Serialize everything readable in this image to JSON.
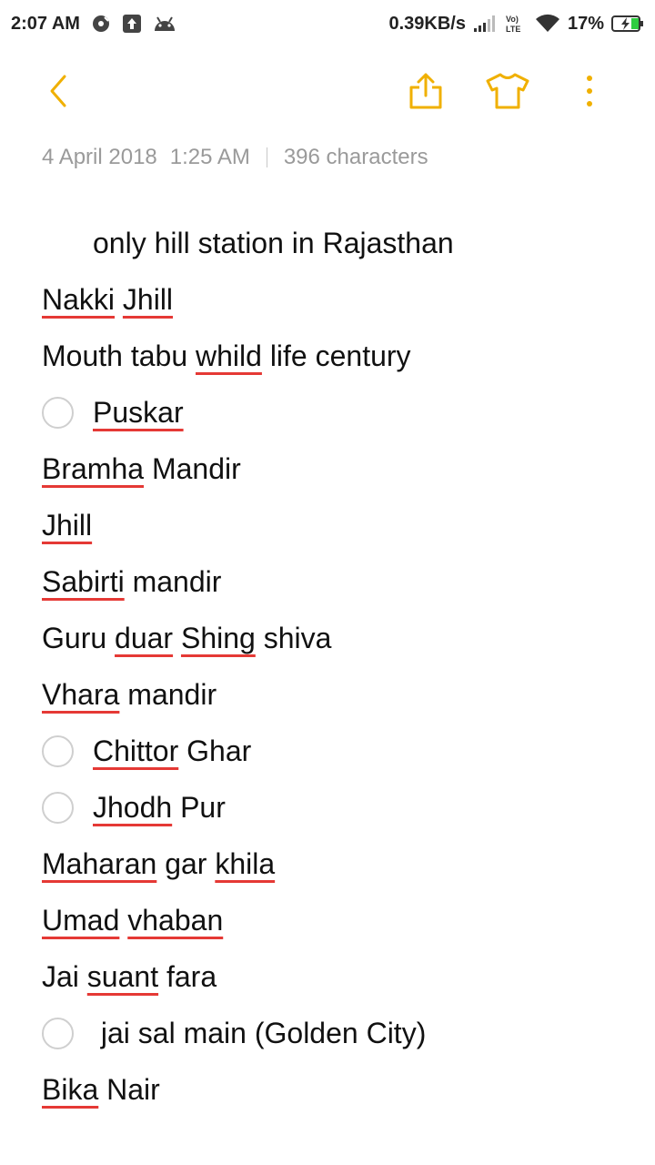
{
  "status_bar": {
    "time": "2:07 AM",
    "net_speed": "0.39KB/s",
    "volte": "Vo) LTE",
    "battery": "17%"
  },
  "toolbar": {
    "back_icon": "chevron-left-icon",
    "share_icon": "share-icon",
    "theme_icon": "tshirt-icon",
    "more_icon": "more-vertical-icon",
    "accent_color": "#f0b000"
  },
  "meta": {
    "date": "4 April 2018",
    "time": "1:25 AM",
    "characters": "396 characters"
  },
  "note": {
    "spellcheck_color": "#e53935",
    "lines": [
      {
        "type": "text",
        "indent": true,
        "segments": [
          {
            "t": "only hill station in Rajasthan"
          }
        ]
      },
      {
        "type": "text",
        "segments": [
          {
            "t": "Nakki",
            "sp": true
          },
          {
            "t": " "
          },
          {
            "t": "Jhill",
            "sp": true
          }
        ]
      },
      {
        "type": "text",
        "segments": [
          {
            "t": "Mouth tabu "
          },
          {
            "t": "whild",
            "sp": true
          },
          {
            "t": " life century"
          }
        ]
      },
      {
        "type": "check",
        "checked": false,
        "segments": [
          {
            "t": "Puskar",
            "sp": true
          }
        ]
      },
      {
        "type": "text",
        "segments": [
          {
            "t": "Bramha",
            "sp": true
          },
          {
            "t": " Mandir"
          }
        ]
      },
      {
        "type": "text",
        "segments": [
          {
            "t": "Jhill",
            "sp": true
          }
        ]
      },
      {
        "type": "text",
        "segments": [
          {
            "t": "Sabirti",
            "sp": true
          },
          {
            "t": " mandir"
          }
        ]
      },
      {
        "type": "text",
        "segments": [
          {
            "t": "Guru "
          },
          {
            "t": "duar",
            "sp": true
          },
          {
            "t": " "
          },
          {
            "t": "Shing",
            "sp": true
          },
          {
            "t": " shiva"
          }
        ]
      },
      {
        "type": "text",
        "segments": [
          {
            "t": "Vhara",
            "sp": true
          },
          {
            "t": " mandir"
          }
        ]
      },
      {
        "type": "check",
        "checked": false,
        "segments": [
          {
            "t": "Chittor",
            "sp": true
          },
          {
            "t": " Ghar"
          }
        ]
      },
      {
        "type": "check",
        "checked": false,
        "segments": [
          {
            "t": "Jhodh",
            "sp": true
          },
          {
            "t": " Pur"
          }
        ]
      },
      {
        "type": "text",
        "segments": [
          {
            "t": "Maharan",
            "sp": true
          },
          {
            "t": " gar "
          },
          {
            "t": "khila",
            "sp": true
          }
        ]
      },
      {
        "type": "text",
        "segments": [
          {
            "t": "Umad",
            "sp": true
          },
          {
            "t": " "
          },
          {
            "t": "vhaban",
            "sp": true
          }
        ]
      },
      {
        "type": "text",
        "segments": [
          {
            "t": "Jai "
          },
          {
            "t": "suant",
            "sp": true
          },
          {
            "t": " fara"
          }
        ]
      },
      {
        "type": "check",
        "checked": false,
        "segments": [
          {
            "t": " jai sal main (Golden City)"
          }
        ]
      },
      {
        "type": "text",
        "segments": [
          {
            "t": "Bika",
            "sp": true
          },
          {
            "t": " Nair"
          }
        ]
      }
    ]
  }
}
